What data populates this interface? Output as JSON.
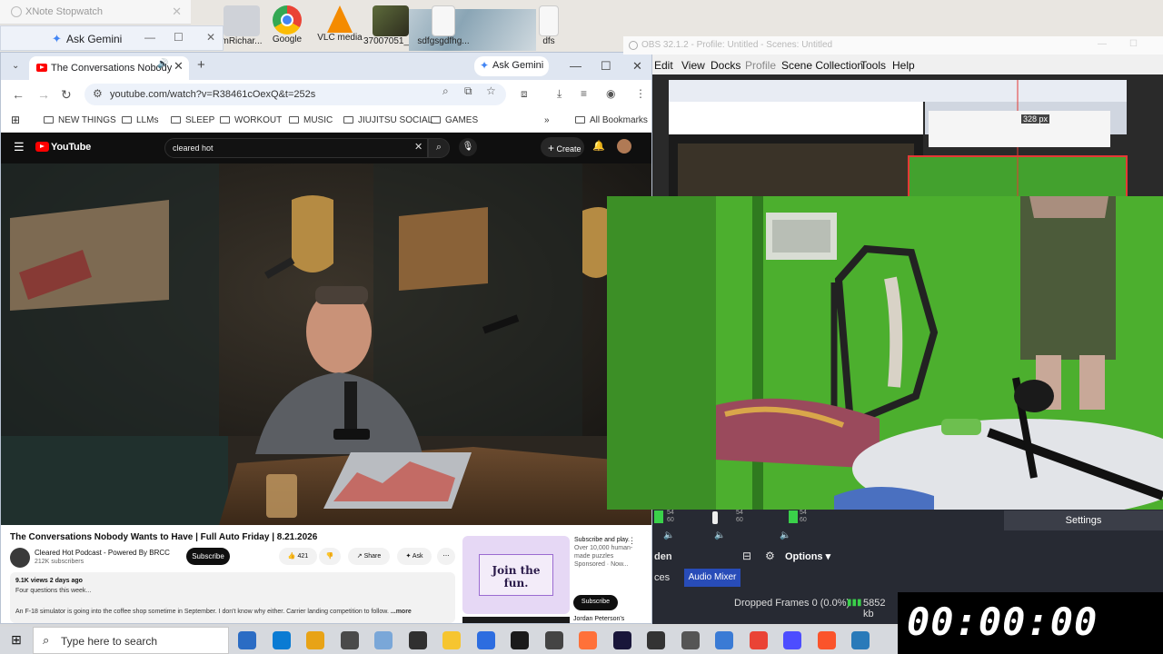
{
  "desktop": {
    "icons": [
      {
        "label": "mRichar...",
        "color": "#c9ccd2"
      },
      {
        "label": "Google",
        "color": "#4285f4"
      },
      {
        "label": "VLC media",
        "color": "#f48b00"
      },
      {
        "label": "37007051_6...",
        "color": "#6f7b4a"
      },
      {
        "label": "sdfgsgdfhg...",
        "color": "#f3f3f3"
      },
      {
        "label": "dfs",
        "color": "#f3f3f3"
      }
    ]
  },
  "xnote": {
    "title": "XNote Stopwatch",
    "close": "✕"
  },
  "gemini_float": {
    "label": "Ask Gemini"
  },
  "chrome": {
    "tab_title": "The Conversations Nobody",
    "new_tab": "+",
    "ask_gemini": "Ask Gemini",
    "url": "youtube.com/watch?v=R38461cOexQ&t=252s",
    "window_controls": {
      "minimize": "—",
      "maximize": "☐",
      "close": "✕"
    },
    "bookmarks": [
      "NEW THINGS",
      "LLMs",
      "SLEEP",
      "WORKOUT",
      "MUSIC",
      "JIUJITSU SOCIAL",
      "GAMES"
    ],
    "all_bookmarks": "All Bookmarks"
  },
  "youtube": {
    "logo": "YouTube",
    "search_query": "cleared hot",
    "create": "Create",
    "video_title": "The Conversations Nobody Wants to Have | Full Auto Friday | 8.21.2026",
    "channel": "Cleared Hot Podcast - Powered By BRCC",
    "subscribers": "212K subscribers",
    "subscribe": "Subscribe",
    "likes": "421",
    "share": "Share",
    "ask": "Ask",
    "views_date": "9.1K views  2 days ago",
    "desc_line1": "Four questions this week...",
    "desc_line2": "An F-18 simulator is going into the coffee shop sometime in September. I don't know why either. Carrier landing competition to follow.",
    "more": "...more",
    "ad": {
      "image_text": "Join the fun.",
      "headline": "Subscribe and play.",
      "body": "Over 10,000 human-made puzzles",
      "sponsored": "Sponsored · Now...",
      "cta": "Subscribe",
      "next_channel": "Jordan Peterson's"
    }
  },
  "obs": {
    "title": "OBS 32.1.2 - Profile: Untitled - Scenes: Untitled",
    "menus": [
      "Edit",
      "View",
      "Docks",
      "Profile",
      "Scene Collection",
      "Tools",
      "Help"
    ],
    "settings": "Settings",
    "options": "Options",
    "audio_mixer": "Audio Mixer",
    "tab_sources_suffix": "ces",
    "tab_hidden_suffix": "den",
    "dropped_frames": "Dropped Frames 0 (0.0%)",
    "bitrate": "5852 kb",
    "preview_badge": "328 px",
    "meter_values": [
      "54",
      "60",
      "54",
      "60",
      "54",
      "60"
    ]
  },
  "stopwatch": {
    "display": "00:00:00"
  },
  "taskbar": {
    "search_placeholder": "Type here to search",
    "apps": [
      "#2b6cc4",
      "#0a7bd3",
      "#e8a317",
      "#4a4a4a",
      "#7aa7d8",
      "#303030",
      "#f6c530",
      "#2d6de0",
      "#1a1a1a",
      "#444",
      "#ff7139",
      "#19163a",
      "#333",
      "#555",
      "#3a7bd5",
      "#ea4335",
      "#4d4dff",
      "#fb542b",
      "#2a7ab9"
    ]
  }
}
